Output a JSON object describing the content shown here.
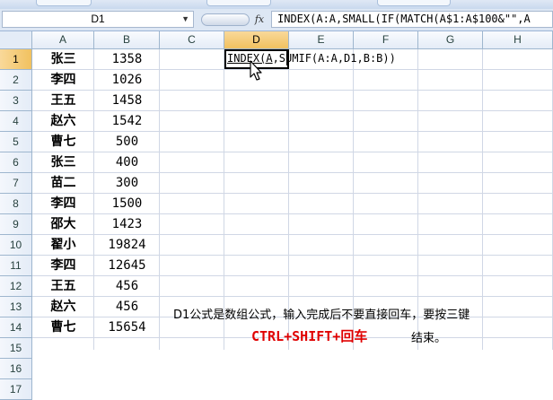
{
  "formula_bar": {
    "name_box": "D1",
    "fx_label": "fx",
    "formula": "INDEX(A:A,SMALL(IF(MATCH(A$1:A$100&\"\",A"
  },
  "columns": [
    "A",
    "B",
    "C",
    "D",
    "E",
    "F",
    "G",
    "H"
  ],
  "selected_column": "D",
  "rows": [
    {
      "num": "1",
      "name": "张三",
      "value": "1358"
    },
    {
      "num": "2",
      "name": "李四",
      "value": "1026"
    },
    {
      "num": "3",
      "name": "王五",
      "value": "1458"
    },
    {
      "num": "4",
      "name": "赵六",
      "value": "1542"
    },
    {
      "num": "5",
      "name": "曹七",
      "value": "500"
    },
    {
      "num": "6",
      "name": "张三",
      "value": "400"
    },
    {
      "num": "7",
      "name": "苗二",
      "value": "300"
    },
    {
      "num": "8",
      "name": "李四",
      "value": "1500"
    },
    {
      "num": "9",
      "name": "邵大",
      "value": "1423"
    },
    {
      "num": "10",
      "name": "翟小",
      "value": "19824"
    },
    {
      "num": "11",
      "name": "李四",
      "value": "12645"
    },
    {
      "num": "12",
      "name": "王五",
      "value": "456"
    },
    {
      "num": "13",
      "name": "赵六",
      "value": "456"
    },
    {
      "num": "14",
      "name": "曹七",
      "value": "15654"
    },
    {
      "num": "15",
      "name": "",
      "value": ""
    },
    {
      "num": "16",
      "name": "",
      "value": ""
    },
    {
      "num": "17",
      "name": "",
      "value": ""
    }
  ],
  "selected_row": "1",
  "edit_cell": {
    "text_part1": "INDEX(A",
    "text_part2": ",SUMIF(A:A,D1,B:B))"
  },
  "note": {
    "line1": "D1公式是数组公式，输入完成后不要直接回车，要按三键",
    "keys": "CTRL+SHIFT+回车",
    "line2_end": "结束。"
  }
}
